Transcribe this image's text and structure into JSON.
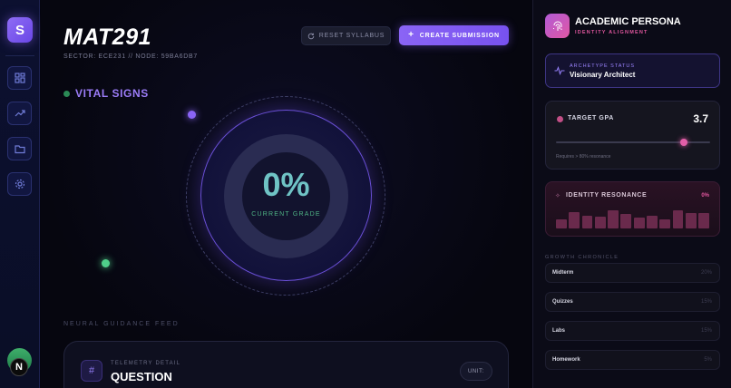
{
  "rail": {
    "logo_letter": "S",
    "nav_icons": [
      "dashboard-icon",
      "trend-icon",
      "folder-icon",
      "settings-icon"
    ],
    "avatar_badge": "N"
  },
  "header": {
    "course_code": "MAT291",
    "meta": "SECTOR: ECE231 // NODE: 59BA6DB7",
    "reset_label": "RESET SYLLABUS",
    "create_label": "CREATE SUBMISSION"
  },
  "vitals": {
    "title": "VITAL SIGNS",
    "grade_value": "0%",
    "grade_label": "CURRENT GRADE"
  },
  "feed": {
    "title": "NEURAL GUIDANCE FEED",
    "card_icon": "#",
    "detail_label": "TELEMETRY DETAIL",
    "detail_value": "QUESTION",
    "unit_label": "UNIT:"
  },
  "persona": {
    "title": "ACADEMIC PERSONA",
    "subtitle": "IDENTITY ALIGNMENT",
    "archetype_label": "ARCHETYPE STATUS",
    "archetype_value": "Visionary Architect",
    "gpa_label": "TARGET GPA",
    "gpa_value": "3.7",
    "gpa_slider_fraction": 0.83,
    "gpa_note": "Requires > 80% resonance",
    "resonance_label": "IDENTITY RESONANCE",
    "resonance_value": "0%",
    "resonance_bars": [
      0.4,
      0.75,
      0.6,
      0.55,
      0.85,
      0.65,
      0.5,
      0.6,
      0.4,
      0.85,
      0.7,
      0.7
    ],
    "chronicle_title": "GROWTH CHRONICLE",
    "chronicle": [
      {
        "name": "Midterm",
        "weight": "20%"
      },
      {
        "name": "Quizzes",
        "weight": "15%"
      },
      {
        "name": "Labs",
        "weight": "15%"
      },
      {
        "name": "Homework",
        "weight": "5%"
      }
    ]
  },
  "colors": {
    "accent": "#8a64f5",
    "pink": "#e0579e",
    "grade": "#6fc3c5",
    "green": "#4fd08a"
  }
}
